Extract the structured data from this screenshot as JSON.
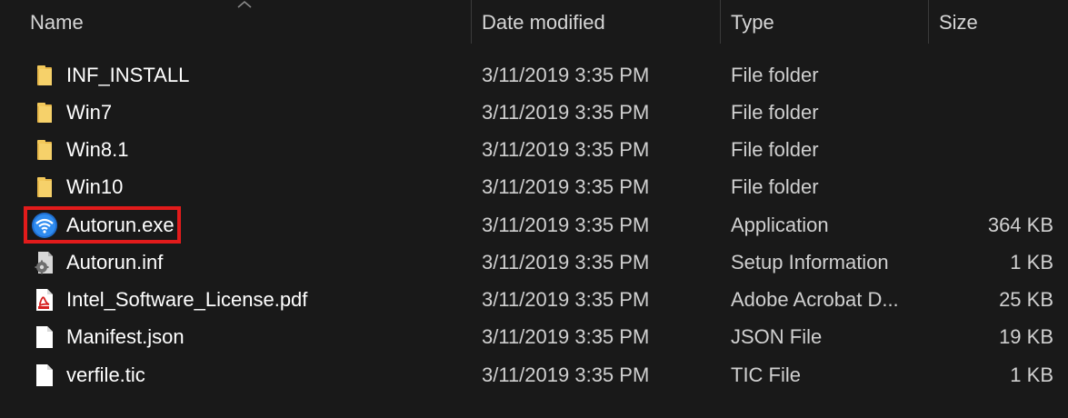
{
  "columns": {
    "name": "Name",
    "date_modified": "Date modified",
    "type": "Type",
    "size": "Size"
  },
  "sort": {
    "column": "name",
    "direction": "ascending",
    "icon": "chevron-up-icon"
  },
  "highlight_color": "#e21b1b",
  "files": [
    {
      "name": "INF_INSTALL",
      "date": "3/11/2019 3:35 PM",
      "type": "File folder",
      "size": "",
      "icon": "folder-icon"
    },
    {
      "name": "Win7",
      "date": "3/11/2019 3:35 PM",
      "type": "File folder",
      "size": "",
      "icon": "folder-icon"
    },
    {
      "name": "Win8.1",
      "date": "3/11/2019 3:35 PM",
      "type": "File folder",
      "size": "",
      "icon": "folder-icon"
    },
    {
      "name": "Win10",
      "date": "3/11/2019 3:35 PM",
      "type": "File folder",
      "size": "",
      "icon": "folder-icon"
    },
    {
      "name": "Autorun.exe",
      "date": "3/11/2019 3:35 PM",
      "type": "Application",
      "size": "364 KB",
      "icon": "wifi-app-icon",
      "highlighted": true
    },
    {
      "name": "Autorun.inf",
      "date": "3/11/2019 3:35 PM",
      "type": "Setup Information",
      "size": "1 KB",
      "icon": "settings-file-icon"
    },
    {
      "name": "Intel_Software_License.pdf",
      "date": "3/11/2019 3:35 PM",
      "type": "Adobe Acrobat D...",
      "size": "25 KB",
      "icon": "pdf-file-icon"
    },
    {
      "name": "Manifest.json",
      "date": "3/11/2019 3:35 PM",
      "type": "JSON File",
      "size": "19 KB",
      "icon": "blank-file-icon"
    },
    {
      "name": "verfile.tic",
      "date": "3/11/2019 3:35 PM",
      "type": "TIC File",
      "size": "1 KB",
      "icon": "blank-file-icon"
    }
  ]
}
